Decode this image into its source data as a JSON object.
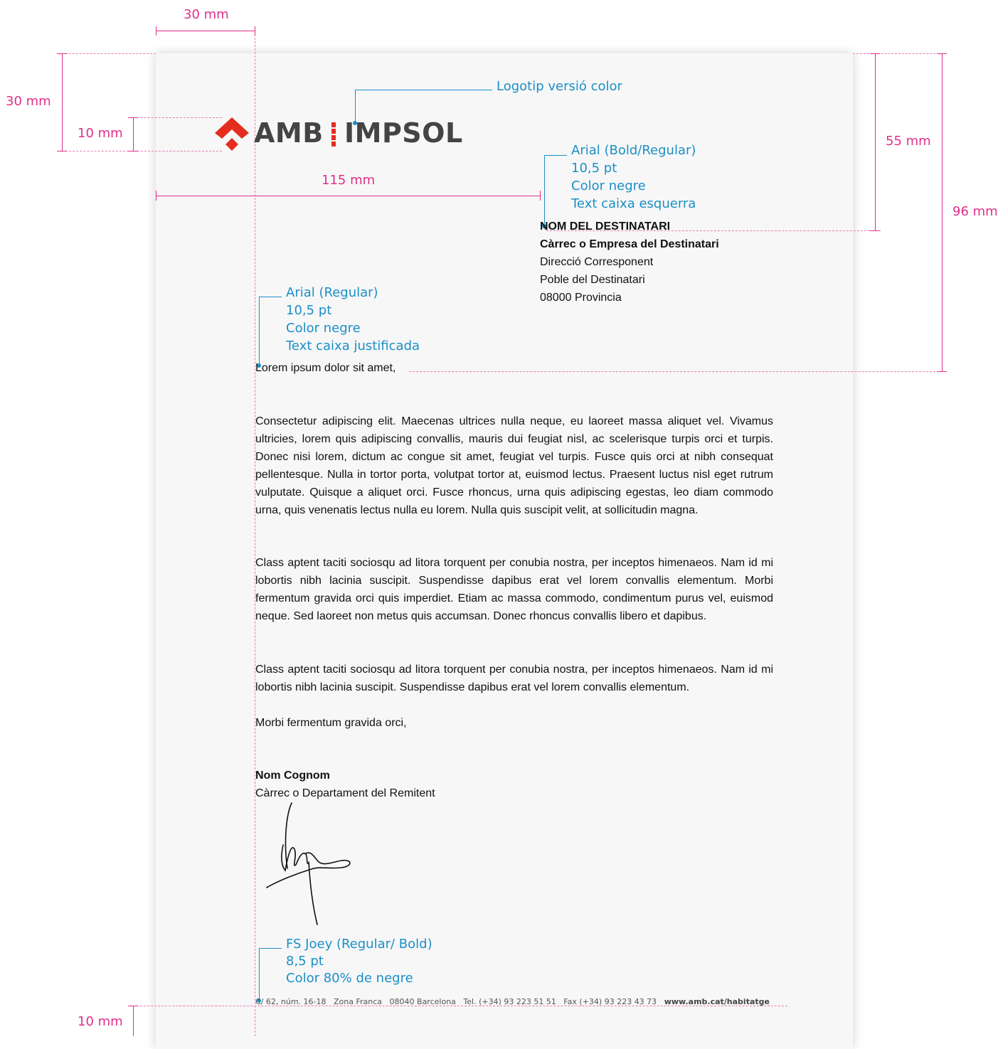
{
  "measures": {
    "left_margin": "30 mm",
    "top_margin": "30 mm",
    "logo_height": "10 mm",
    "address_offset": "115 mm",
    "address_top": "55 mm",
    "body_top": "96 mm",
    "bottom_margin": "10 mm"
  },
  "annotations": {
    "logo": "Logotip versió color",
    "address": [
      "Arial (Bold/Regular)",
      "10,5 pt",
      "Color negre",
      "Text caixa esquerra"
    ],
    "body": [
      "Arial (Regular)",
      "10,5 pt",
      "Color negre",
      "Text caixa justificada"
    ],
    "footer": [
      "FS Joey (Regular/ Bold)",
      "8,5 pt",
      "Color 80% de negre"
    ]
  },
  "logo": {
    "left": "AMB",
    "right": "IMPSOL",
    "colors": {
      "red": "#e42d1f",
      "gray": "#444444"
    }
  },
  "recipient": {
    "name": "NOM DEL DESTINATARI",
    "position": "Càrrec o Empresa del Destinatari",
    "street": "Direcció Corresponent",
    "town": "Poble del Destinatari",
    "postal": "08000 Provincia"
  },
  "letter": {
    "greeting": "Lorem ipsum dolor sit amet,",
    "paragraphs": [
      "Consectetur adipiscing elit. Maecenas ultrices nulla neque, eu laoreet massa aliquet vel. Vivamus ultricies, lorem quis adipiscing convallis, mauris dui feugiat nisl, ac scelerisque turpis orci et turpis. Donec nisi lorem, dictum ac congue sit amet, feugiat vel turpis. Fusce quis orci at nibh consequat pellentesque. Nulla in tortor porta, volutpat tortor at, euismod lectus. Praesent luctus nisl eget rutrum vulputate. Quisque a aliquet orci. Fusce rhoncus, urna quis adipiscing egestas, leo diam commodo urna, quis venenatis lectus nulla eu lorem. Nulla quis suscipit velit, at sollicitudin magna.",
      "Class aptent taciti sociosqu ad litora torquent per conubia nostra, per inceptos himenaeos. Nam id mi lobortis nibh lacinia suscipit. Suspendisse dapibus erat vel lorem convallis elementum. Morbi fermentum gravida orci quis imperdiet. Etiam ac massa commodo, condimentum purus vel, euismod neque. Sed laoreet non metus quis accumsan. Donec rhoncus convallis libero et dapibus.",
      "Class aptent taciti sociosqu ad litora torquent per conubia nostra, per inceptos himenaeos. Nam id mi lobortis nibh lacinia suscipit. Suspendisse dapibus erat vel lorem convallis elementum."
    ],
    "closing": "Morbi fermentum gravida orci,",
    "sender_name": "Nom Cognom",
    "sender_role": "Càrrec o Departament del Remitent"
  },
  "footer": {
    "street": "C/ 62, núm. 16-18",
    "zone": "Zona Franca",
    "city": "08040 Barcelona",
    "tel": "Tel. (+34) 93 223 51 51",
    "fax": "Fax (+34) 93 223 43 73",
    "web": "www.amb.cat/habitatge"
  }
}
